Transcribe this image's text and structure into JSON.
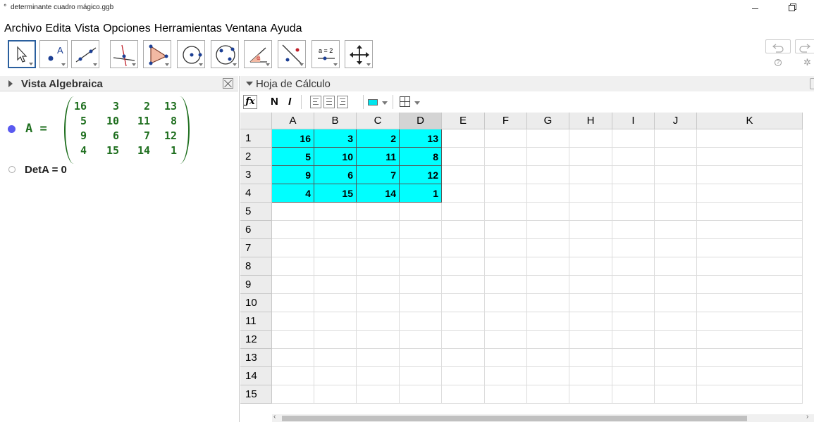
{
  "window": {
    "title": "determinante cuadro mágico.ggb",
    "icon": "geogebra-icon"
  },
  "menu": [
    "Archivo",
    "Edita",
    "Vista",
    "Opciones",
    "Herramientas",
    "Ventana",
    "Ayuda"
  ],
  "toolbar": {
    "tools": [
      {
        "name": "move-tool-icon"
      },
      {
        "name": "point-tool-icon",
        "label": "A"
      },
      {
        "name": "line-tool-icon"
      },
      {
        "name": "perpendicular-line-tool-icon"
      },
      {
        "name": "polygon-tool-icon"
      },
      {
        "name": "circle-tool-icon"
      },
      {
        "name": "conic-tool-icon"
      },
      {
        "name": "angle-tool-icon",
        "label": "α"
      },
      {
        "name": "reflect-tool-icon"
      },
      {
        "name": "slider-tool-icon",
        "label": "a = 2"
      },
      {
        "name": "move-view-tool-icon"
      }
    ],
    "active_tool": "move-tool-icon"
  },
  "algebra_view": {
    "title": "Vista Algebraica",
    "matrix": {
      "label": "A =",
      "rows": [
        [
          "16",
          "3",
          "2",
          "13"
        ],
        [
          "5",
          "10",
          "11",
          "8"
        ],
        [
          "9",
          "6",
          "7",
          "12"
        ],
        [
          "4",
          "15",
          "14",
          "1"
        ]
      ],
      "color": "#1f6f1f"
    },
    "determinant": "DetA = 0"
  },
  "spreadsheet": {
    "title": "Hoja de Cálculo",
    "format_bar": {
      "bold": "N",
      "italic": "I",
      "fx": "fx"
    },
    "fill_color": "#00ffff",
    "columns": [
      "A",
      "B",
      "C",
      "D",
      "E",
      "F",
      "G",
      "H",
      "I",
      "J",
      "K"
    ],
    "selected_column": "D",
    "row_labels": [
      "1",
      "2",
      "3",
      "4",
      "5",
      "6",
      "7",
      "8",
      "9",
      "10",
      "11",
      "12",
      "13",
      "14",
      "15"
    ],
    "cells": [
      [
        "16",
        "3",
        "2",
        "13"
      ],
      [
        "5",
        "10",
        "11",
        "8"
      ],
      [
        "9",
        "6",
        "7",
        "12"
      ],
      [
        "4",
        "15",
        "14",
        "1"
      ]
    ]
  }
}
